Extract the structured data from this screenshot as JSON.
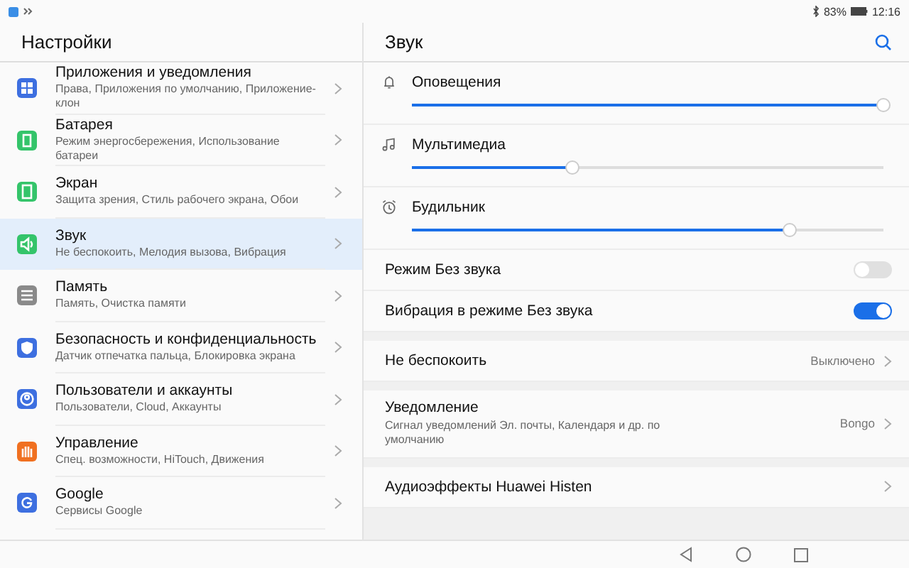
{
  "status_bar": {
    "battery": "83%",
    "time": "12:16"
  },
  "sidebar": {
    "title": "Настройки",
    "items": [
      {
        "kind": "apps",
        "title": "Приложения и уведомления",
        "subtitle": "Права, Приложения по умолчанию, Приложение-клон",
        "selected": false,
        "color": "#3d6fe0"
      },
      {
        "kind": "battery",
        "title": "Батарея",
        "subtitle": "Режим энергосбережения, Использование батареи",
        "selected": false,
        "color": "#34c46a"
      },
      {
        "kind": "screen",
        "title": "Экран",
        "subtitle": "Защита зрения, Стиль рабочего экрана, Обои",
        "selected": false,
        "color": "#34c46a"
      },
      {
        "kind": "sound",
        "title": "Звук",
        "subtitle": "Не беспокоить, Мелодия вызова, Вибрация",
        "selected": true,
        "color": "#34c46a"
      },
      {
        "kind": "storage",
        "title": "Память",
        "subtitle": "Память, Очистка памяти",
        "selected": false,
        "color": "#8a8a8a"
      },
      {
        "kind": "security",
        "title": "Безопасность и конфиденциальность",
        "subtitle": "Датчик отпечатка пальца, Блокировка экрана",
        "selected": false,
        "color": "#3d6fe0"
      },
      {
        "kind": "users",
        "title": "Пользователи и аккаунты",
        "subtitle": "Пользователи, Cloud, Аккаунты",
        "selected": false,
        "color": "#3d6fe0"
      },
      {
        "kind": "hand",
        "title": "Управление",
        "subtitle": "Спец. возможности, HiTouch, Движения",
        "selected": false,
        "color": "#f07020"
      },
      {
        "kind": "google",
        "title": "Google",
        "subtitle": "Сервисы Google",
        "selected": false,
        "color": "#3d6fe0"
      }
    ]
  },
  "panel": {
    "title": "Звук",
    "volumes": [
      {
        "kind": "bell",
        "label": "Оповещения",
        "level": 1.0
      },
      {
        "kind": "music",
        "label": "Мультимедиа",
        "level": 0.34
      },
      {
        "kind": "alarm",
        "label": "Будильник",
        "level": 0.8
      }
    ],
    "sections": [
      [
        {
          "kind": "toggle",
          "label": "Режим Без звука",
          "on": false
        },
        {
          "kind": "toggle",
          "label": "Вибрация в режиме Без звука",
          "on": true
        }
      ],
      [
        {
          "kind": "link",
          "label": "Не беспокоить",
          "value": "Выключено"
        }
      ],
      [
        {
          "kind": "link",
          "label": "Уведомление",
          "subtitle": "Сигнал уведомлений Эл. почты, Календаря и др. по умолчанию",
          "value": "Bongo"
        }
      ],
      [
        {
          "kind": "link",
          "label": "Аудиоэффекты Huawei Histen"
        }
      ]
    ]
  }
}
